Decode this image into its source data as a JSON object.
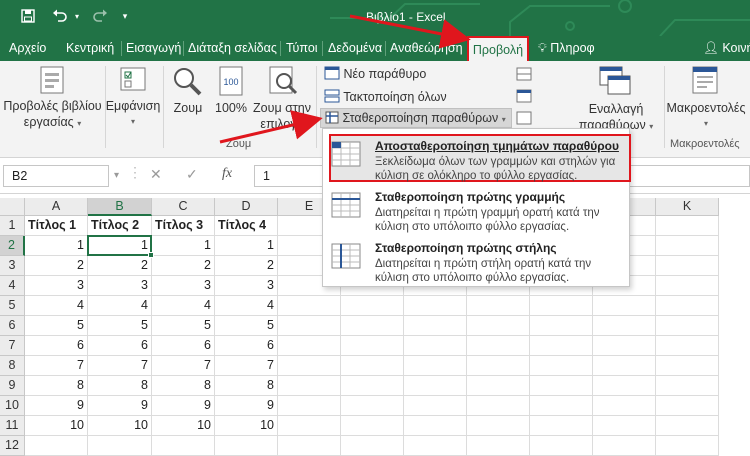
{
  "window": {
    "title": "Βιβλίο1 - Excel",
    "accent": "#217346"
  },
  "qat": {
    "save_icon": "save-icon",
    "undo_icon": "undo-icon",
    "redo_icon": "redo-icon",
    "customize_icon": "chevron-down-icon"
  },
  "tabs": {
    "file": "Αρχείο",
    "home": "Κεντρική",
    "insert": "Εισαγωγή",
    "page_layout": "Διάταξη σελίδας",
    "formulas": "Τύποι",
    "data": "Δεδομένα",
    "review": "Αναθεώρηση",
    "view": "Προβολή",
    "tell_me": "Πληροφ",
    "signin": "Κοινή"
  },
  "ribbon": {
    "workbook_views_line1": "Προβολές βιβλίου",
    "workbook_views_line2": "εργασίας",
    "show": "Εμφάνιση",
    "zoom": "Ζουμ",
    "zoom100": "100%",
    "zoom_selection_line1": "Ζουμ στην",
    "zoom_selection_line2": "επιλογή",
    "zoom_group": "Ζουμ",
    "new_window": "Νέο παράθυρο",
    "arrange_all": "Τακτοποίηση όλων",
    "freeze_panes": "Σταθεροποίηση παραθύρων",
    "switch_windows_line1": "Εναλλαγή",
    "switch_windows_line2": "παραθύρων",
    "macros": "Μακροεντολές",
    "macros_group": "Μακροεντολές"
  },
  "formula_bar": {
    "name_box": "B2",
    "cancel": "✕",
    "enter": "✓",
    "fx": "fx",
    "value": "1"
  },
  "grid": {
    "columns": [
      "A",
      "B",
      "C",
      "D",
      "E",
      "F",
      "G",
      "H",
      "I",
      "J",
      "K"
    ],
    "rows": [
      "1",
      "2",
      "3",
      "4",
      "5",
      "6",
      "7",
      "8",
      "9",
      "10",
      "11",
      "12"
    ],
    "headers": [
      "Τίτλος 1",
      "Τίτλος 2",
      "Τίτλος 3",
      "Τίτλος 4"
    ],
    "values": [
      [
        "1",
        "1",
        "1",
        "1"
      ],
      [
        "2",
        "2",
        "2",
        "2"
      ],
      [
        "3",
        "3",
        "3",
        "3"
      ],
      [
        "4",
        "4",
        "4",
        "4"
      ],
      [
        "5",
        "5",
        "5",
        "5"
      ],
      [
        "6",
        "6",
        "6",
        "6"
      ],
      [
        "7",
        "7",
        "7",
        "7"
      ],
      [
        "8",
        "8",
        "8",
        "8"
      ],
      [
        "9",
        "9",
        "9",
        "9"
      ],
      [
        "10",
        "10",
        "10",
        "10"
      ]
    ],
    "selected_cell": "B2"
  },
  "freeze_menu": {
    "items": [
      {
        "title": "Αποσταθεροποίηση τμημάτων παραθύρου",
        "description": "Ξεκλείδωμα όλων των γραμμών και στηλών για κύλιση σε ολόκληρο το φύλλο εργασίας."
      },
      {
        "title": "Σταθεροποίηση πρώτης γραμμής",
        "description": "Διατηρείται η πρώτη γραμμή ορατή κατά την κύλιση στο υπόλοιπο φύλλο εργασίας."
      },
      {
        "title": "Σταθεροποίηση πρώτης στήλης",
        "description": "Διατηρείται η πρώτη στήλη ορατή κατά την κύλιση στο υπόλοιπο φύλλο εργασίας."
      }
    ]
  },
  "annotation_color": "#e0161d"
}
